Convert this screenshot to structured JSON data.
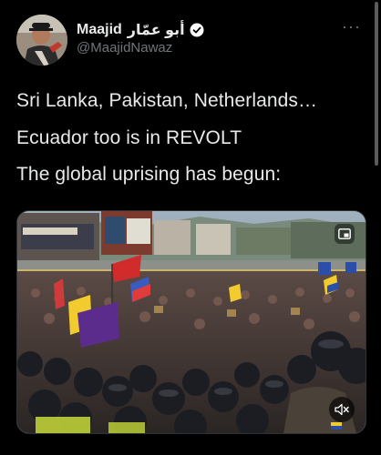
{
  "author": {
    "display_name": "Maajid",
    "display_name_arabic": "أبو عمّار",
    "handle": "@MaajidNawaz",
    "verified": true
  },
  "more_icon": "more-horizontal-icon",
  "tweet": {
    "lines": [
      "Sri Lanka, Pakistan, Netherlands…",
      "Ecuador too is in REVOLT",
      "The global uprising has begun:"
    ]
  },
  "media": {
    "type": "video",
    "pip_icon": "picture-in-picture-icon",
    "mute_icon": "speaker-muted-icon"
  },
  "colors": {
    "background": "#000000",
    "text": "#e7e9ea",
    "secondary_text": "#71767b",
    "verified_badge": "#ffffff"
  }
}
